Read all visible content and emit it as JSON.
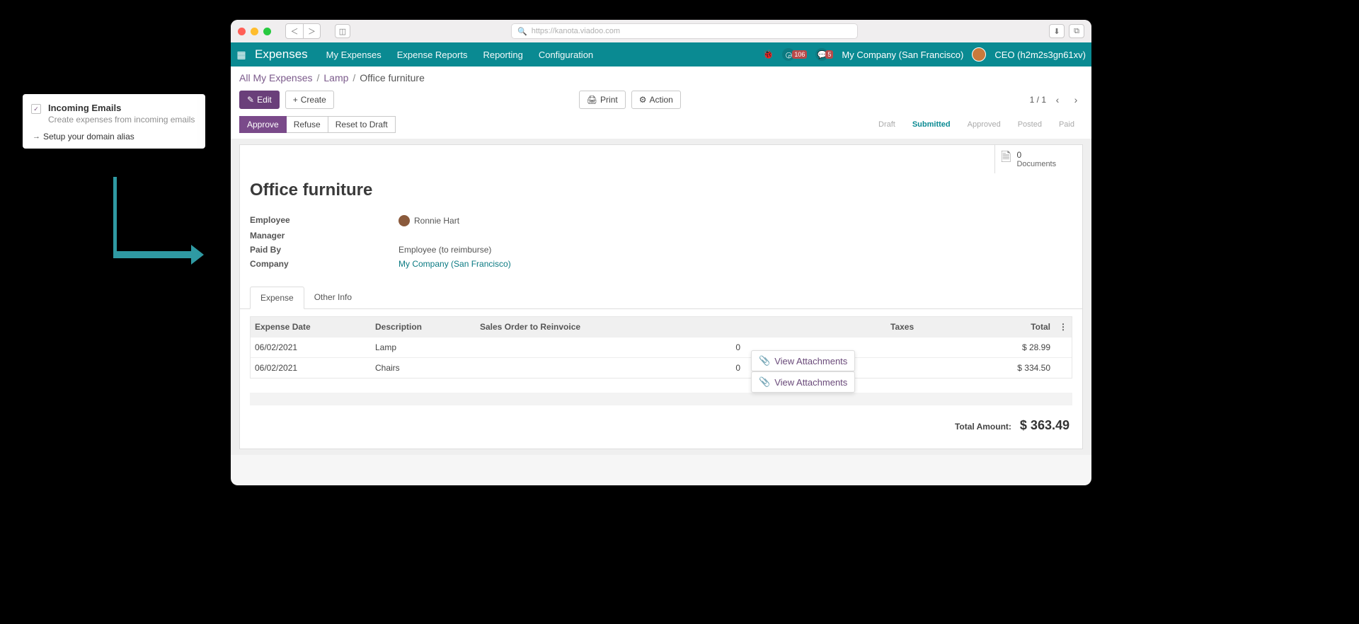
{
  "callout": {
    "title": "Incoming Emails",
    "subtitle": "Create expenses from incoming emails",
    "link_label": "Setup your domain alias"
  },
  "browser": {
    "url": "https://kanota.viadoo.com"
  },
  "nav": {
    "brand": "Expenses",
    "links": [
      "My Expenses",
      "Expense Reports",
      "Reporting",
      "Configuration"
    ],
    "activity_badge": "106",
    "messages_badge": "5",
    "company": "My Company (San Francisco)",
    "user": "CEO (h2m2s3gn61xv)"
  },
  "breadcrumb": {
    "root": "All My Expenses",
    "mid": "Lamp",
    "current": "Office furniture"
  },
  "actions": {
    "edit": "Edit",
    "create": "Create",
    "print": "Print",
    "action": "Action",
    "pager": "1 / 1"
  },
  "status_buttons": {
    "approve": "Approve",
    "refuse": "Refuse",
    "reset": "Reset to Draft"
  },
  "status_arrows": [
    "Draft",
    "Submitted",
    "Approved",
    "Posted",
    "Paid"
  ],
  "status_active_index": 1,
  "documents": {
    "count": "0",
    "label": "Documents"
  },
  "record": {
    "title": "Office furniture",
    "employee_lab": "Employee",
    "employee_val": "Ronnie Hart",
    "manager_lab": "Manager",
    "paidby_lab": "Paid By",
    "paidby_val": "Employee (to reimburse)",
    "company_lab": "Company",
    "company_val": "My Company (San Francisco)"
  },
  "tabs": {
    "expense": "Expense",
    "other": "Other Info"
  },
  "table": {
    "headers": {
      "date": "Expense Date",
      "desc": "Description",
      "sales": "Sales Order to Reinvoice",
      "taxes": "Taxes",
      "total": "Total"
    },
    "rows": [
      {
        "date": "06/02/2021",
        "desc": "Lamp",
        "misc": "0",
        "attach": "View Attachments",
        "total": "$ 28.99"
      },
      {
        "date": "06/02/2021",
        "desc": "Chairs",
        "misc": "0",
        "attach": "View Attachments",
        "total": "$ 334.50"
      }
    ]
  },
  "total": {
    "label": "Total Amount:",
    "value": "$ 363.49"
  }
}
